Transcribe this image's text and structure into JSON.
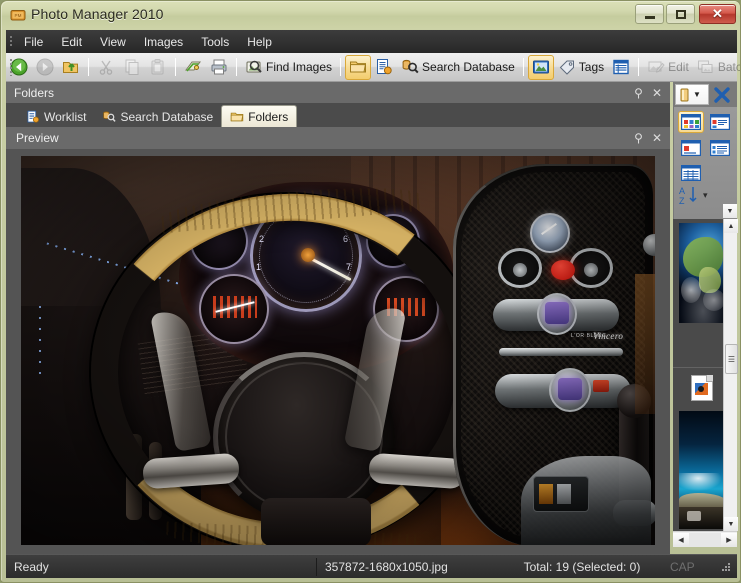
{
  "window": {
    "title": "Photo Manager 2010",
    "icon": "app-photo-icon",
    "controls": {
      "minimize": "Minimize",
      "maximize": "Maximize",
      "close": "Close"
    }
  },
  "menubar": {
    "items": [
      {
        "label": "File"
      },
      {
        "label": "Edit"
      },
      {
        "label": "View"
      },
      {
        "label": "Images"
      },
      {
        "label": "Tools"
      },
      {
        "label": "Help"
      }
    ]
  },
  "toolbar": {
    "items": [
      {
        "label": "",
        "icon": "back-arrow-icon",
        "state": "enabled"
      },
      {
        "label": "",
        "icon": "forward-arrow-icon",
        "state": "disabled"
      },
      {
        "label": "",
        "icon": "up-folder-icon",
        "state": "enabled"
      },
      {
        "label": "",
        "icon": "cut-icon",
        "state": "disabled"
      },
      {
        "label": "",
        "icon": "copy-icon",
        "state": "disabled"
      },
      {
        "label": "",
        "icon": "paste-icon",
        "state": "disabled"
      },
      {
        "label": "",
        "icon": "open-with-icon",
        "state": "enabled"
      },
      {
        "label": "",
        "icon": "print-icon",
        "state": "enabled"
      },
      {
        "label": "Find Images",
        "icon": "find-images-icon",
        "state": "enabled"
      },
      {
        "label": "",
        "icon": "folder-icon",
        "state": "active"
      },
      {
        "label": "",
        "icon": "worklist-icon",
        "state": "enabled"
      },
      {
        "label": "Search Database",
        "icon": "search-database-icon",
        "state": "enabled"
      },
      {
        "label": "",
        "icon": "preview-image-icon",
        "state": "active"
      },
      {
        "label": "Tags",
        "icon": "tags-icon",
        "state": "enabled"
      },
      {
        "label": "",
        "icon": "details-list-icon",
        "state": "enabled"
      },
      {
        "label": "Edit",
        "icon": "edit-icon",
        "state": "disabled"
      },
      {
        "label": "Batch",
        "icon": "batch-icon",
        "state": "disabled"
      }
    ],
    "overflow": "toolbar-overflow-chevron"
  },
  "folders_dock": {
    "title": "Folders",
    "pin": "pin-icon",
    "close": "close-icon"
  },
  "right_widget": {
    "dropdown_icon": "folder-dropdown-icon",
    "close_icon": "close-x-icon"
  },
  "tabs": [
    {
      "label": "Worklist",
      "icon": "worklist-icon",
      "selected": false
    },
    {
      "label": "Search Database",
      "icon": "search-database-icon",
      "selected": false
    },
    {
      "label": "Folders",
      "icon": "folder-icon",
      "selected": true
    }
  ],
  "preview_dock": {
    "title": "Preview",
    "pin": "pin-icon",
    "close": "close-icon",
    "image_alt": "Bugatti Veyron car interior dashboard and steering wheel"
  },
  "view_panel": {
    "buttons": [
      {
        "name": "thumbnails-view",
        "selected": true
      },
      {
        "name": "tiles-view",
        "selected": false
      },
      {
        "name": "icons-view",
        "selected": false
      },
      {
        "name": "list-view",
        "selected": false
      },
      {
        "name": "details-view",
        "selected": false
      }
    ],
    "sort": {
      "icon": "sort-az-icon",
      "chevron": "chevron-down-icon"
    }
  },
  "thumbnail_strip": {
    "items": [
      {
        "name": "thumbnail-earth-globe"
      },
      {
        "name": "thumbnail-broken-image"
      },
      {
        "name": "thumbnail-blue-aerial"
      }
    ],
    "scroll_up": "scroll-up-arrow",
    "scroll_down": "scroll-down-arrow",
    "scroll_left": "scroll-left-arrow",
    "scroll_right": "scroll-right-arrow",
    "dropdown": "panel-dropdown-arrow"
  },
  "statusbar": {
    "status": "Ready",
    "filename": "357872-1680x1050.jpg",
    "totals": "Total: 19 (Selected: 0)",
    "caps": "CAP",
    "grip": "resize-grip"
  },
  "colors": {
    "window_chrome": "#c8cfa3",
    "titlebar_text": "#2b2b20",
    "menubar_bg": "#323232",
    "toolbar_bg": "#e3e3e3",
    "dock_header_bg": "#6a6a6a",
    "tab_strip_bg": "#4b4b4b",
    "preview_bg": "#545454",
    "statusbar_bg": "#333333",
    "accent_gold": "#d9a83a",
    "accent_blue": "#1f5fb0",
    "close_red": "#c24a3b"
  }
}
